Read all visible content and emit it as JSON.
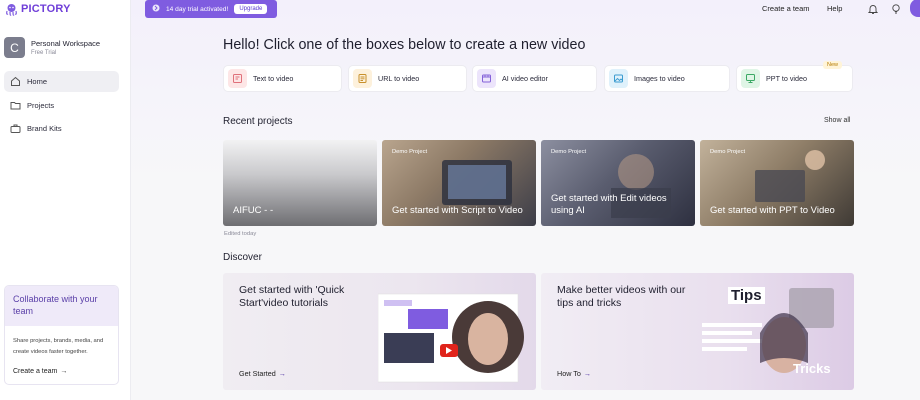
{
  "app": {
    "logo_text": "PICTORY"
  },
  "trial": {
    "text": "14 day trial activated!",
    "upgrade_label": "Upgrade"
  },
  "topbar": {
    "create_team": "Create a team",
    "help": "Help"
  },
  "workspace": {
    "initial": "C",
    "name": "Personal Workspace",
    "plan": "Free Trial"
  },
  "nav": [
    {
      "label": "Home",
      "icon": "home-icon",
      "active": true
    },
    {
      "label": "Projects",
      "icon": "folder-icon",
      "active": false
    },
    {
      "label": "Brand Kits",
      "icon": "briefcase-icon",
      "active": false
    }
  ],
  "collab": {
    "title": "Collaborate with your team",
    "body": "Share projects, brands, media, and create videos faster together.",
    "link": "Create a team"
  },
  "headline": "Hello! Click one of the boxes below to create a new video",
  "create_boxes": [
    {
      "label": "Text to video",
      "icon": "text-to-video-icon"
    },
    {
      "label": "URL to video",
      "icon": "url-to-video-icon"
    },
    {
      "label": "AI video editor",
      "icon": "video-editor-icon"
    },
    {
      "label": "Images to video",
      "icon": "images-to-video-icon"
    },
    {
      "label": "PPT to video",
      "icon": "ppt-to-video-icon",
      "badge": "New"
    }
  ],
  "recent": {
    "title": "Recent projects",
    "show_all": "Show all",
    "projects": [
      {
        "title": "AIFUC - -",
        "tag": "",
        "edited": "Edited today"
      },
      {
        "title": "Get started with Script to Video",
        "tag": "Demo Project"
      },
      {
        "title": "Get started with Edit videos using AI",
        "tag": "Demo Project"
      },
      {
        "title": "Get started with PPT to Video",
        "tag": "Demo Project"
      }
    ]
  },
  "discover": {
    "title": "Discover",
    "cards": [
      {
        "title": "Get started with 'Quick Start'video tutorials",
        "link": "Get Started"
      },
      {
        "title": "Make better videos with our tips and tricks",
        "link": "How To",
        "overlay_top": "Tips",
        "overlay_bottom": "Tricks"
      }
    ]
  },
  "colors": {
    "brand": "#7f5ce0",
    "accent_text": "#5a3fa8"
  }
}
